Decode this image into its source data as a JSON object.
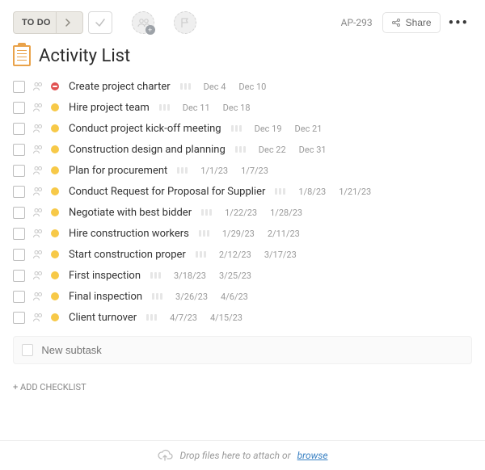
{
  "toolbar": {
    "status_label": "TO DO",
    "id": "AP-293",
    "share_label": "Share"
  },
  "title": "Activity List",
  "tasks": [
    {
      "name": "Create project charter",
      "priority": "red",
      "start": "Dec 4",
      "due": "Dec 10"
    },
    {
      "name": "Hire project team",
      "priority": "yellow",
      "start": "Dec 11",
      "due": "Dec 18"
    },
    {
      "name": "Conduct project kick-off meeting",
      "priority": "yellow",
      "start": "Dec 19",
      "due": "Dec 21"
    },
    {
      "name": "Construction design and planning",
      "priority": "yellow",
      "start": "Dec 22",
      "due": "Dec 31"
    },
    {
      "name": "Plan for procurement",
      "priority": "yellow",
      "start": "1/1/23",
      "due": "1/7/23"
    },
    {
      "name": "Conduct Request for Proposal for Supplier",
      "priority": "yellow",
      "start": "1/8/23",
      "due": "1/21/23"
    },
    {
      "name": "Negotiate with best bidder",
      "priority": "yellow",
      "start": "1/22/23",
      "due": "1/28/23"
    },
    {
      "name": "Hire construction workers",
      "priority": "yellow",
      "start": "1/29/23",
      "due": "2/11/23"
    },
    {
      "name": "Start construction proper",
      "priority": "yellow",
      "start": "2/12/23",
      "due": "3/17/23"
    },
    {
      "name": "First inspection",
      "priority": "yellow",
      "start": "3/18/23",
      "due": "3/25/23"
    },
    {
      "name": "Final inspection",
      "priority": "yellow",
      "start": "3/26/23",
      "due": "4/6/23"
    },
    {
      "name": "Client turnover",
      "priority": "yellow",
      "start": "4/7/23",
      "due": "4/15/23"
    }
  ],
  "new_subtask_placeholder": "New subtask",
  "add_checklist_label": "+ ADD CHECKLIST",
  "dropzone": {
    "text": "Drop files here to attach or ",
    "link": "browse"
  }
}
